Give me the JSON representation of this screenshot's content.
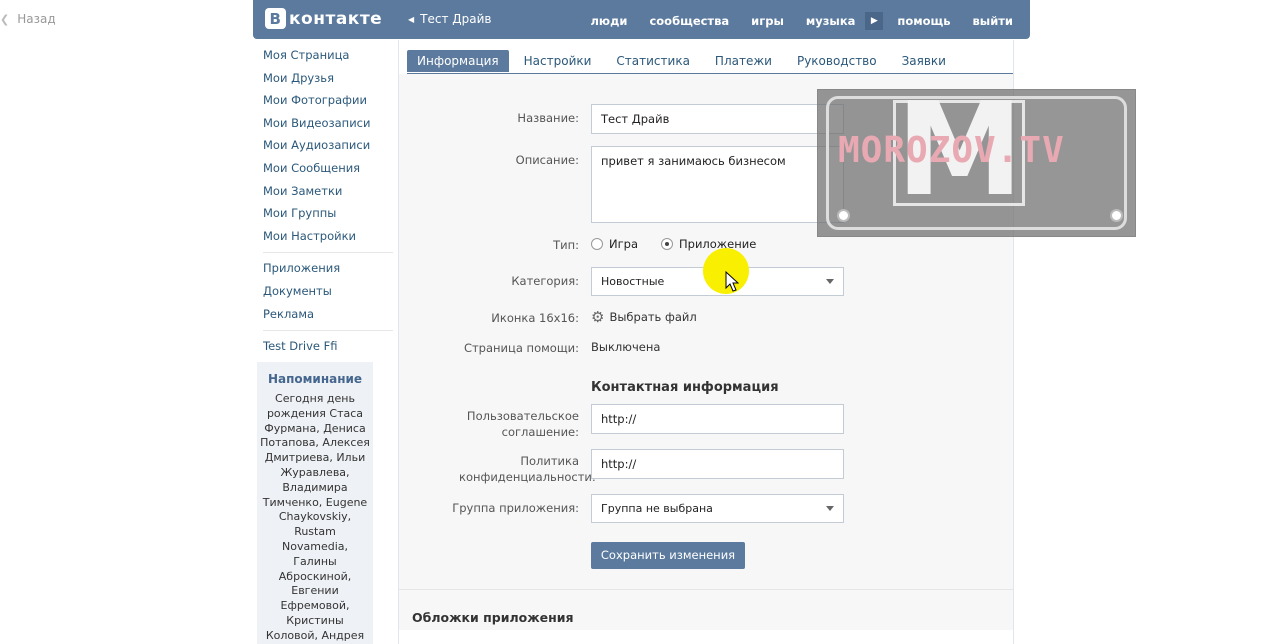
{
  "back_label": "Назад",
  "header": {
    "logo_letter": "В",
    "logo_text": "контакте",
    "crumb_arrow": "◀",
    "crumb": "Тест Драйв",
    "nav": [
      "люди",
      "сообщества",
      "игры",
      "музыка",
      "помощь",
      "выйти"
    ],
    "play_glyph": "▶"
  },
  "sidebar": {
    "group1": [
      "Моя Страница",
      "Мои Друзья",
      "Мои Фотографии",
      "Мои Видеозаписи",
      "Мои Аудиозаписи",
      "Мои Сообщения",
      "Мои Заметки",
      "Мои Группы",
      "Мои Настройки"
    ],
    "group2": [
      "Приложения",
      "Документы",
      "Реклама"
    ],
    "group3": [
      "Test Drive Ffi"
    ]
  },
  "reminder": {
    "title": "Напоминание",
    "text": "Сегодня день рождения Стаса Фурмана, Дениса Потапова, Алексея Дмитриева, Ильи Журавлева, Владимира Тимченко, Eugene Chaykovskiy, Rustam Novamedia, Галины Аброскиной, Евгении Ефремовой, Кристины Коловой, Андрея"
  },
  "tabs": [
    "Информация",
    "Настройки",
    "Статистика",
    "Платежи",
    "Руководство",
    "Заявки"
  ],
  "form": {
    "name_label": "Название:",
    "name_value": "Тест Драйв",
    "desc_label": "Описание:",
    "desc_value": "привет я занимаюсь бизнесом",
    "type_label": "Тип:",
    "type_game": "Игра",
    "type_app": "Приложение",
    "category_label": "Категория:",
    "category_value": "Новостные",
    "icon_label": "Иконка 16x16:",
    "icon_action": "Выбрать файл",
    "help_label": "Страница помощи:",
    "help_value": "Выключена",
    "contact_title": "Контактная информация",
    "agreement_label": "Пользовательское соглашение:",
    "agreement_value": "http://",
    "privacy_label": "Политика конфиденциальности:",
    "privacy_value": "http://",
    "group_label": "Группа приложения:",
    "group_value": "Группа не выбрана",
    "save_button": "Сохранить изменения",
    "covers_title": "Обложки приложения"
  },
  "watermark": {
    "letter": "M",
    "text": "MOROZOV.TV"
  }
}
